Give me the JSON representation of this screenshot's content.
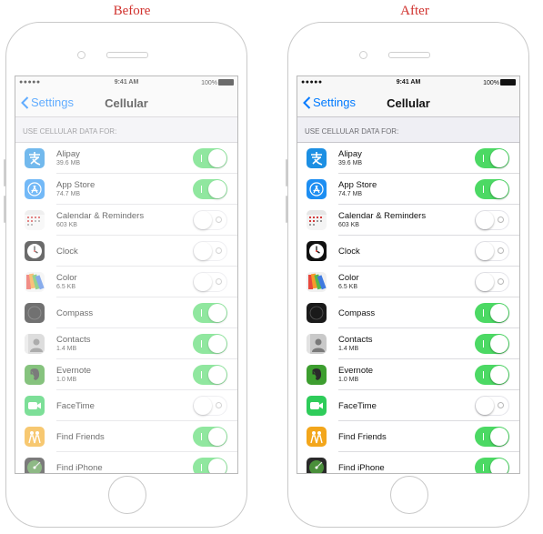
{
  "captions": {
    "before": "Before",
    "after": "After"
  },
  "status": {
    "dots": "●●●●● ",
    "time": "9:41 AM",
    "battery": "100%"
  },
  "nav": {
    "back_label": "Settings",
    "title": "Cellular"
  },
  "section_header": "USE CELLULAR DATA FOR:",
  "colors": {
    "accent": "#007aff",
    "toggle_on": "#4cd964",
    "caption": "#d0312d"
  },
  "before_apps": [
    {
      "name": "Alipay",
      "size": "39.6 MB",
      "on": true,
      "icon": "alipay-icon"
    },
    {
      "name": "App Store",
      "size": "74.7 MB",
      "on": true,
      "icon": "app-store-icon"
    },
    {
      "name": "Calendar & Reminders",
      "size": "603 KB",
      "on": false,
      "icon": "calendar-icon"
    },
    {
      "name": "Clock",
      "size": "",
      "on": false,
      "icon": "clock-icon"
    },
    {
      "name": "Color",
      "size": "6.5 KB",
      "on": false,
      "icon": "color-icon"
    },
    {
      "name": "Compass",
      "size": "",
      "on": true,
      "icon": "compass-icon"
    },
    {
      "name": "Contacts",
      "size": "1.4 MB",
      "on": true,
      "icon": "contacts-icon"
    },
    {
      "name": "Evernote",
      "size": "1.0 MB",
      "on": true,
      "icon": "evernote-icon"
    },
    {
      "name": "FaceTime",
      "size": "",
      "on": false,
      "icon": "facetime-icon"
    },
    {
      "name": "Find Friends",
      "size": "",
      "on": true,
      "icon": "find-friends-icon"
    },
    {
      "name": "Find iPhone",
      "size": "",
      "on": true,
      "icon": "find-iphone-icon"
    }
  ],
  "after_apps": [
    {
      "name": "Alipay",
      "size": "39.6 MB",
      "on": true,
      "icon": "alipay-icon"
    },
    {
      "name": "App Store",
      "size": "74.7 MB",
      "on": true,
      "icon": "app-store-icon"
    },
    {
      "name": "Calendar & Reminders",
      "size": "603 KB",
      "on": false,
      "icon": "calendar-icon"
    },
    {
      "name": "Clock",
      "size": "",
      "on": false,
      "icon": "clock-icon"
    },
    {
      "name": "Color",
      "size": "6.5 KB",
      "on": false,
      "icon": "color-icon"
    },
    {
      "name": "Compass",
      "size": "",
      "on": true,
      "icon": "compass-icon"
    },
    {
      "name": "Contacts",
      "size": "1.4 MB",
      "on": true,
      "icon": "contacts-icon"
    },
    {
      "name": "Evernote",
      "size": "1.0 MB",
      "on": true,
      "icon": "evernote-icon"
    },
    {
      "name": "FaceTime",
      "size": "",
      "on": false,
      "icon": "facetime-icon"
    },
    {
      "name": "Find Friends",
      "size": "",
      "on": true,
      "icon": "find-friends-icon"
    },
    {
      "name": "Find iPhone",
      "size": "",
      "on": true,
      "icon": "find-iphone-icon"
    }
  ]
}
